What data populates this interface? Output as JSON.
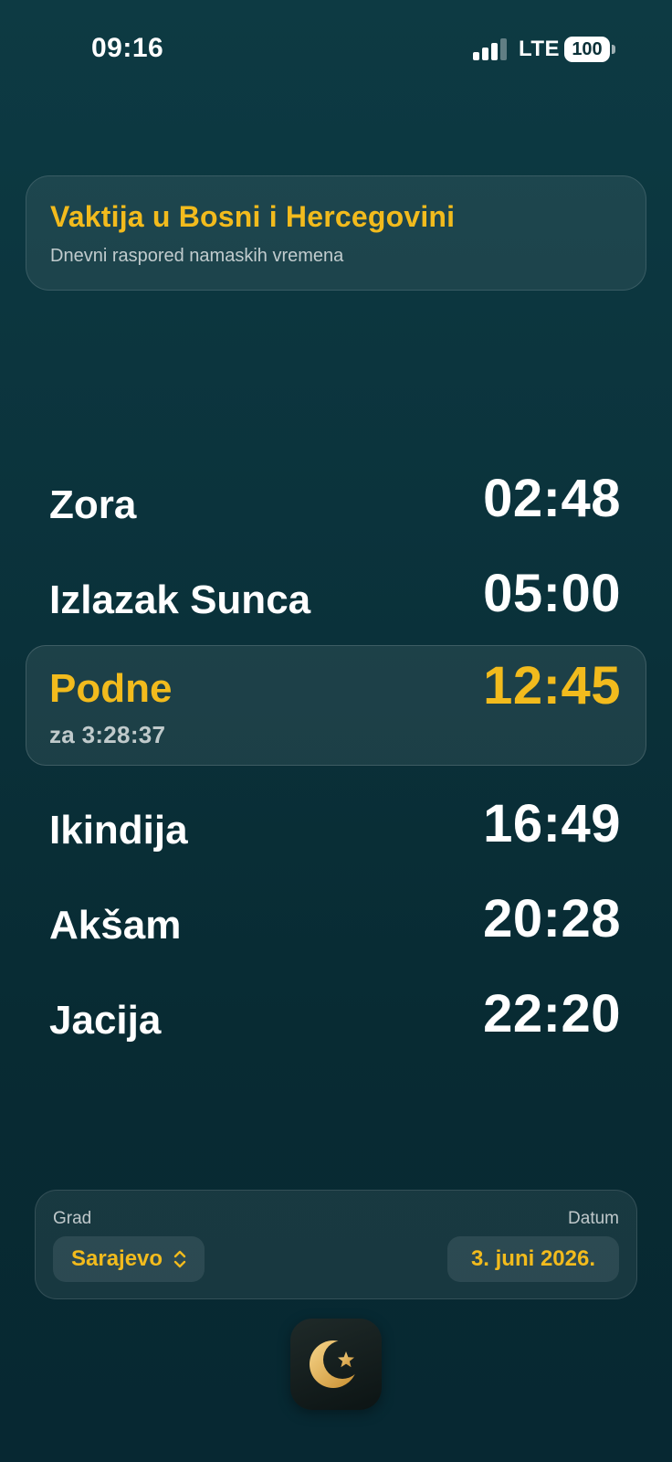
{
  "status_bar": {
    "time": "09:16",
    "network": "LTE",
    "battery": "100"
  },
  "header": {
    "title": "Vaktija u Bosni i Hercegovini",
    "subtitle": "Dnevni raspored namaskih vremena"
  },
  "prayers": [
    {
      "name": "Zora",
      "time": "02:48"
    },
    {
      "name": "Izlazak Sunca",
      "time": "05:00"
    },
    {
      "name": "Podne",
      "time": "12:45",
      "countdown": "za 3:28:37"
    },
    {
      "name": "Ikindija",
      "time": "16:49"
    },
    {
      "name": "Akšam",
      "time": "20:28"
    },
    {
      "name": "Jacija",
      "time": "22:20"
    }
  ],
  "selector": {
    "city_label": "Grad",
    "city_value": "Sarajevo",
    "date_label": "Datum",
    "date_value": "3. juni 2026."
  },
  "colors": {
    "accent": "#f2bb1d",
    "background": "#0b333c"
  },
  "icons": {
    "app_icon": "crescent-star-icon",
    "city_chevron": "chevron-up-down-icon"
  }
}
